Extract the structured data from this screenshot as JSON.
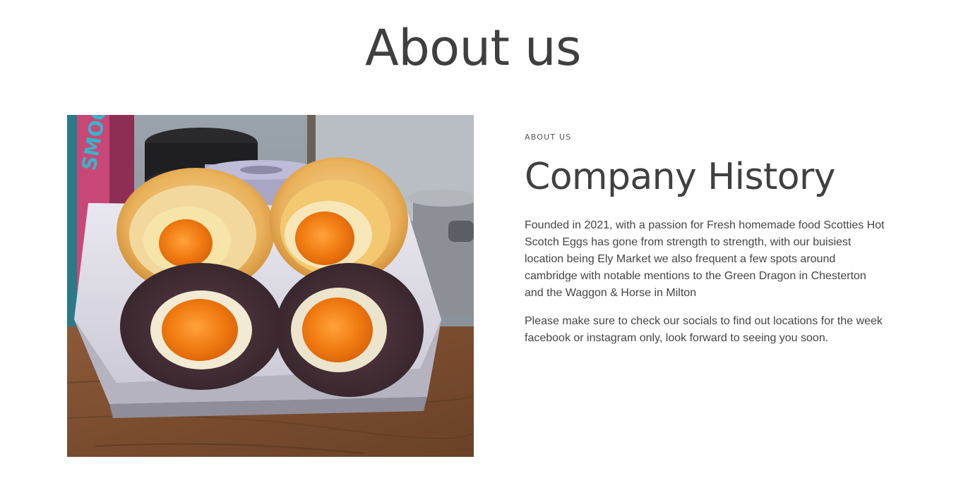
{
  "header": {
    "title": "About us"
  },
  "image": {
    "alt": "Scotch eggs cut in half in a paper tray"
  },
  "section": {
    "eyebrow": "ABOUT US",
    "title": "Company History",
    "paragraphs": [
      "Founded in 2021, with a passion for Fresh homemade food Scotties Hot Scotch Eggs has gone from strength to strength, with our buisiest location being Ely Market we also frequent a few spots around cambridge with notable mentions to the Green Dragon in Chesterton and the Waggon & Horse in Milton",
      "Please make sure to check our socials to find out locations for the week facebook or instagram only, look forward to seeing you soon."
    ]
  },
  "colors": {
    "text": "#444444",
    "title": "#3f3f3f",
    "background": "#ffffff",
    "yolk": "#f07a10",
    "crust": "#e6a54a",
    "blackpudding": "#4a3238"
  }
}
